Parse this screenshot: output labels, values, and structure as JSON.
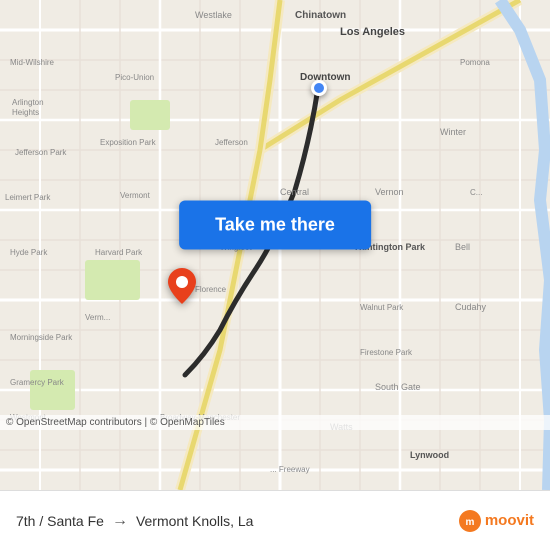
{
  "map": {
    "background_color": "#f0ece4",
    "route_color": "#333",
    "origin_color": "#4285f4",
    "dest_color": "#e8401c"
  },
  "button": {
    "label": "Take me there",
    "bg_color": "#1a73e8"
  },
  "footer": {
    "origin_label": "7th / Santa Fe",
    "arrow": "→",
    "dest_label": "Vermont Knolls, La",
    "copyright": "© OpenStreetMap contributors | © OpenMapTiles"
  },
  "moovit": {
    "logo_text": "moovit"
  }
}
